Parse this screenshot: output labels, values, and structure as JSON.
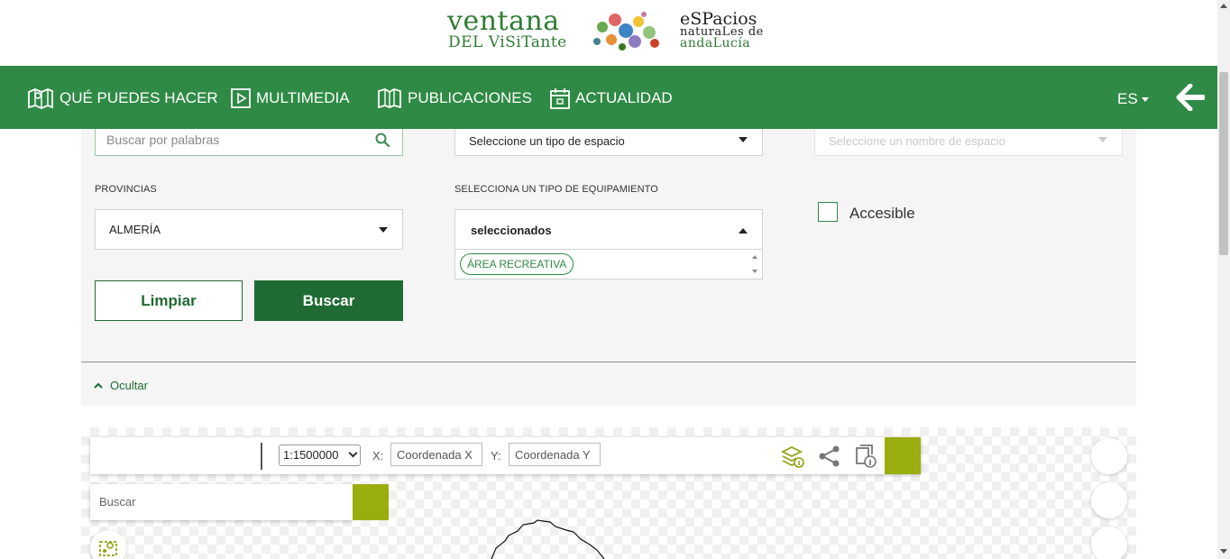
{
  "logo": {
    "line1": "ventana",
    "line2": "DEL ViSiTante",
    "right1": "eSPacios",
    "right2": "naturaLes de",
    "right3": "andaLucía"
  },
  "nav": {
    "items": [
      {
        "label": "QUÉ PUEDES HACER",
        "icon": "map-icon"
      },
      {
        "label": "MULTIMEDIA",
        "icon": "play-icon"
      },
      {
        "label": "PUBLICACIONES",
        "icon": "book-icon"
      },
      {
        "label": "ACTUALIDAD",
        "icon": "calendar-icon"
      }
    ],
    "lang": "ES",
    "back_icon": "arrow-left-icon"
  },
  "search": {
    "keyword_placeholder": "Buscar por palabras",
    "tipo_espacio": "Seleccione un tipo de espacio",
    "nombre_espacio": "Seleccione un nombre de espacio",
    "provincias_label": "PROVINCIAS",
    "provincia_value": "ALMERÍA",
    "equipamiento_label": "SELECCIONA UN TIPO DE EQUIPAMIENTO",
    "equipamiento_value": "seleccionados",
    "selected_tags": [
      "ÁREA RECREATIVA"
    ],
    "accesible_label": "Accesible",
    "clear_label": "Limpiar",
    "search_label": "Buscar",
    "hide_label": "Ocultar"
  },
  "map": {
    "scale": "1:1500000",
    "x_label": "X:",
    "y_label": "Y:",
    "coord_x_placeholder": "Coordenada X",
    "coord_y_placeholder": "Coordenada Y",
    "search_placeholder": "Buscar",
    "colors": {
      "accent": "#9aad0f",
      "nav": "#2f8a45",
      "button": "#1f6b33"
    }
  }
}
